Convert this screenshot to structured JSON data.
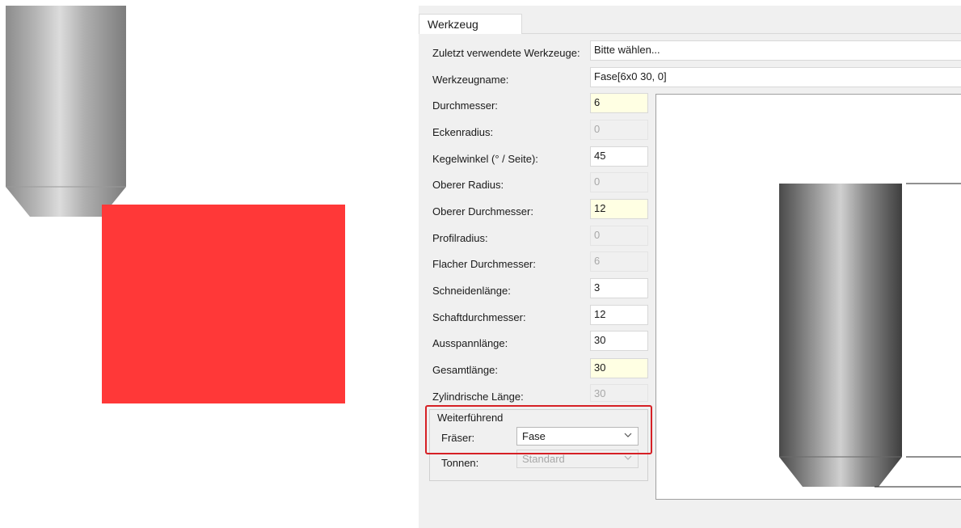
{
  "colors": {
    "accent_red": "#ff3838",
    "highlight_border": "#d62025",
    "input_yellow": "#ffffe3"
  },
  "tab": {
    "label": "Werkzeug"
  },
  "recent_tools": {
    "label": "Zuletzt verwendete Werkzeuge:",
    "value": "Bitte wählen..."
  },
  "tool_name": {
    "label": "Werkzeugname:",
    "value": "Fase[6x0 30, 0]"
  },
  "params": [
    {
      "label": "Durchmesser:",
      "value": "6",
      "state": "required"
    },
    {
      "label": "Eckenradius:",
      "value": "0",
      "state": "disabled"
    },
    {
      "label": "Kegelwinkel (° / Seite):",
      "value": "45",
      "state": "normal"
    },
    {
      "label": "Oberer Radius:",
      "value": "0",
      "state": "disabled"
    },
    {
      "label": "Oberer Durchmesser:",
      "value": "12",
      "state": "required"
    },
    {
      "label": "Profilradius:",
      "value": "0",
      "state": "disabled"
    },
    {
      "label": "Flacher Durchmesser:",
      "value": "6",
      "state": "disabled"
    },
    {
      "label": "Schneidenlänge:",
      "value": "3",
      "state": "normal"
    },
    {
      "label": "Schaftdurchmesser:",
      "value": "12",
      "state": "normal"
    },
    {
      "label": "Ausspannlänge:",
      "value": "30",
      "state": "normal"
    },
    {
      "label": "Gesamtlänge:",
      "value": "30",
      "state": "required"
    },
    {
      "label": "Zylindrische Länge:",
      "value": "30",
      "state": "disabled"
    }
  ],
  "advanced": {
    "title": "Weiterführend",
    "cutter_label": "Fräser:",
    "cutter_value": "Fase",
    "barrel_label": "Tonnen:",
    "barrel_value": "Standard"
  },
  "icons": {
    "dropdown": "chevron-down-icon"
  }
}
